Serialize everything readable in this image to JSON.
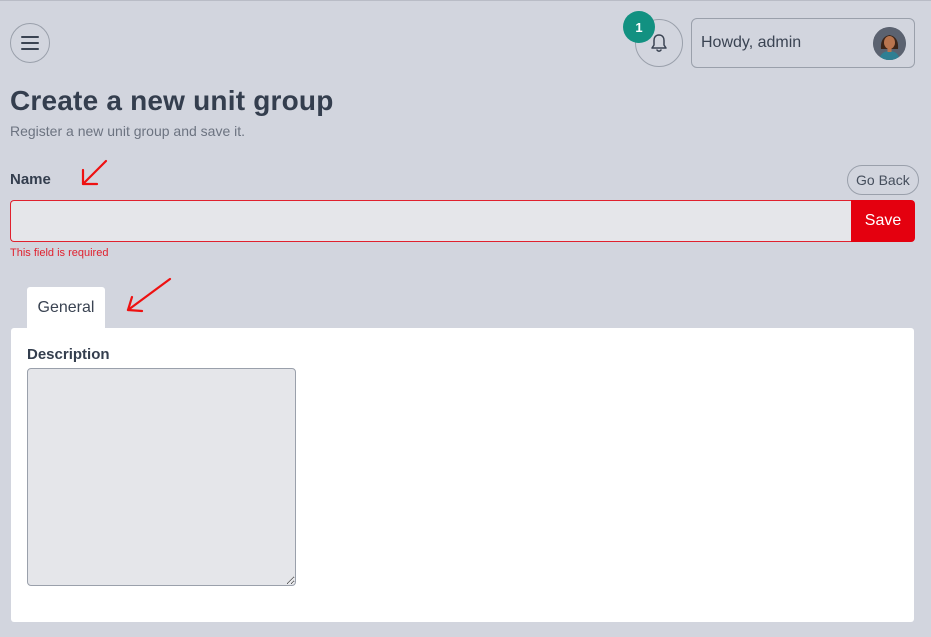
{
  "header": {
    "notification_count": "1",
    "greeting": "Howdy, admin"
  },
  "page": {
    "title": "Create a new unit group",
    "subtitle": "Register a new unit group and save it."
  },
  "form": {
    "name_label": "Name",
    "name_value": "",
    "go_back_label": "Go Back",
    "save_label": "Save",
    "error_message": "This field is required"
  },
  "tabs": [
    {
      "label": "General",
      "active": true
    }
  ],
  "general": {
    "description_label": "Description",
    "description_value": ""
  },
  "icons": {
    "menu": "hamburger-icon",
    "notifications": "bell-icon",
    "avatar": "user-avatar"
  },
  "colors": {
    "background": "#d2d5de",
    "accent_red": "#e4000f",
    "badge_teal": "#129181",
    "error": "#e0212e"
  }
}
